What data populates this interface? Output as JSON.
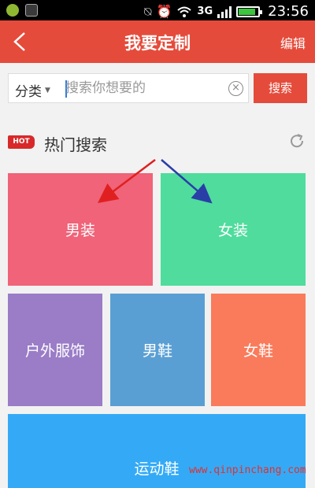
{
  "status_bar": {
    "network": "3G",
    "time": "23:56",
    "battery_level": 0.85,
    "icons": [
      "app-notification-icon",
      "image-notification-icon",
      "mute-icon",
      "alarm-icon",
      "wifi-icon",
      "signal-icon",
      "battery-icon"
    ]
  },
  "header": {
    "title": "我要定制",
    "edit_label": "编辑",
    "back_icon": "chevron-left-icon",
    "background": "#e54b3b"
  },
  "search": {
    "category_label": "分类",
    "placeholder": "搜索你想要的",
    "value": "",
    "button_label": "搜索"
  },
  "hot": {
    "tag": "HOT",
    "label": "热门搜索",
    "refresh_icon": "refresh-icon"
  },
  "tiles": [
    {
      "label": "男装",
      "color": "#f06378"
    },
    {
      "label": "女装",
      "color": "#4fdc9d"
    },
    {
      "label": "户外服饰",
      "color": "#9a7cc7"
    },
    {
      "label": "男鞋",
      "color": "#5a9fd4"
    },
    {
      "label": "女鞋",
      "color": "#f97b5b"
    },
    {
      "label": "运动鞋",
      "color": "#34aaf6"
    }
  ],
  "annotations": {
    "arrow_colors": [
      "#e02020",
      "#2a3ea8"
    ]
  },
  "watermark": "www.qinpinchang.com"
}
